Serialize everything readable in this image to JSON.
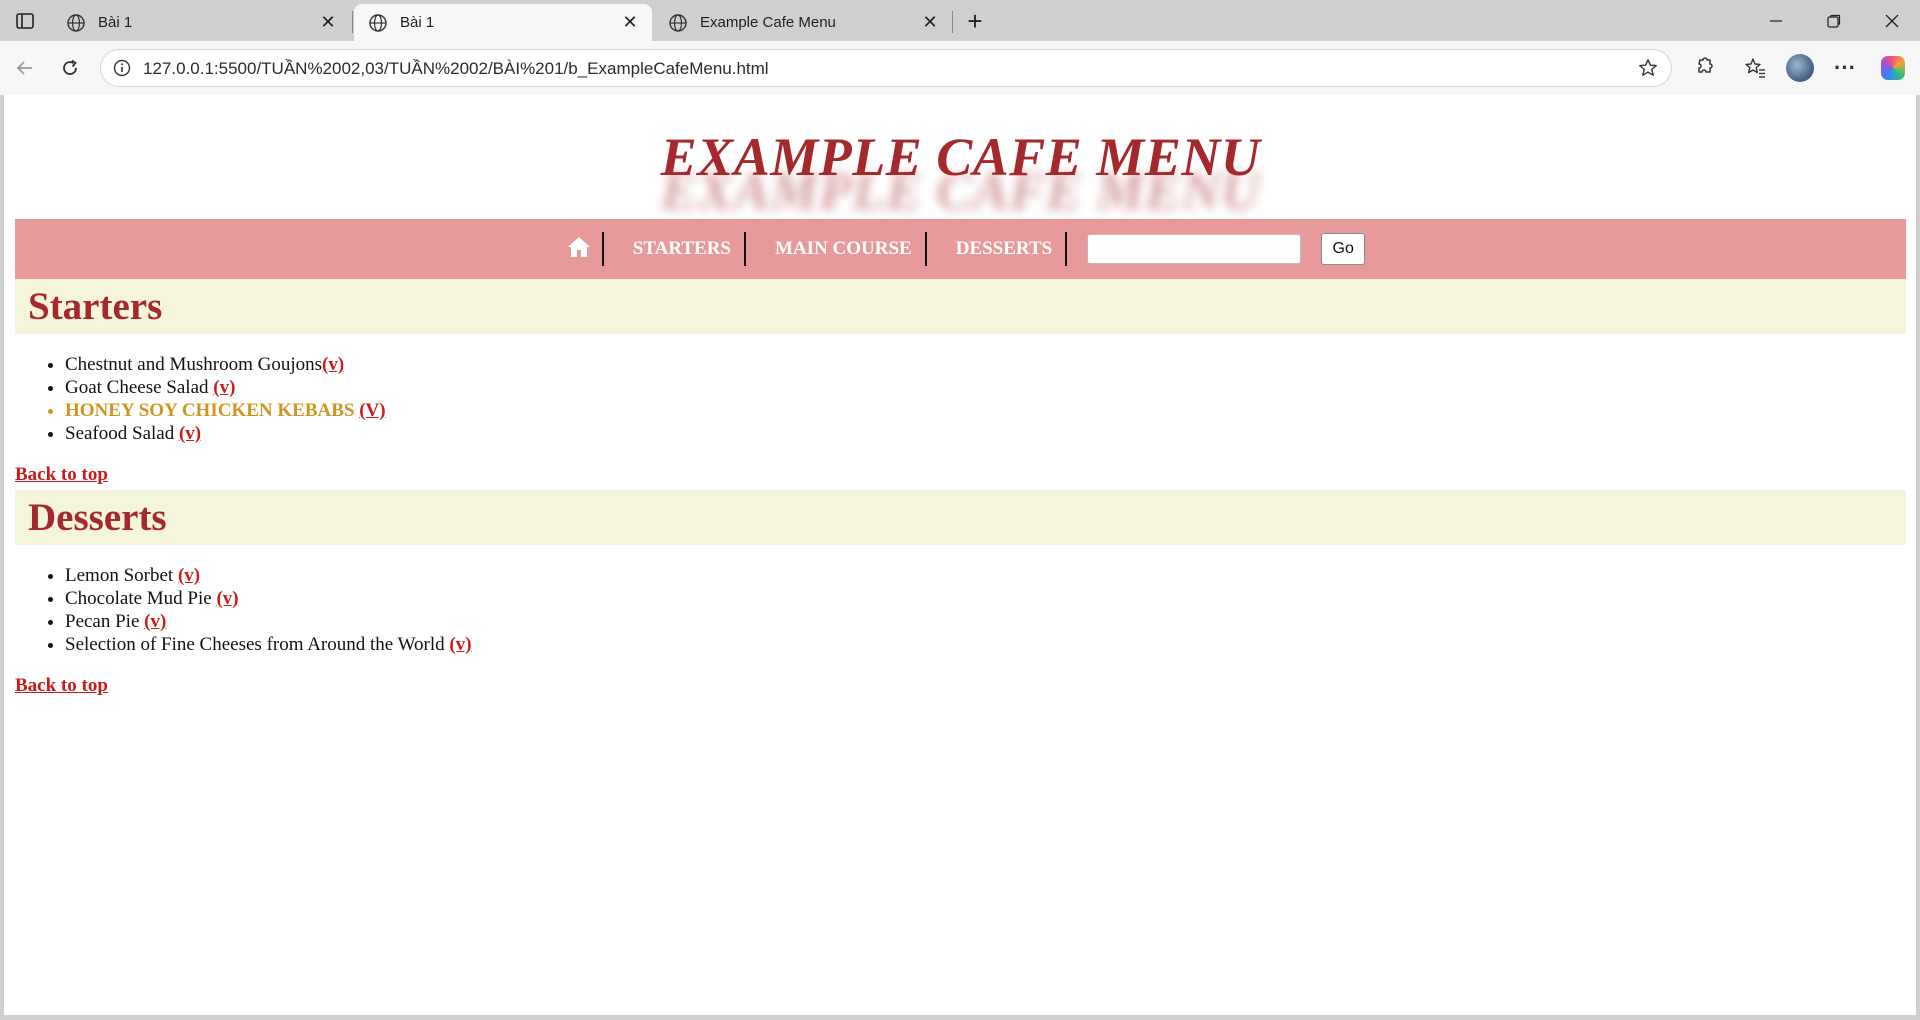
{
  "browser": {
    "tabs": [
      {
        "title": "Bài 1",
        "active": false
      },
      {
        "title": "Bài 1",
        "active": true
      },
      {
        "title": "Example Cafe Menu",
        "active": false
      }
    ],
    "address": "127.0.0.1:5500/TUẦN%2002,03/TUẦN%2002/BÀI%201/b_ExampleCafeMenu.html",
    "icons": [
      "tab-actions-icon",
      "globe-icon",
      "close-icon",
      "new-tab-icon",
      "minimize-icon",
      "restore-icon",
      "window-close-icon",
      "back-icon",
      "reload-icon",
      "site-info-icon",
      "favorite-star-icon",
      "extensions-icon",
      "favorites-icon",
      "profile-avatar",
      "more-icon",
      "copilot-icon"
    ]
  },
  "page": {
    "title": "EXAMPLE CAFE MENU",
    "nav": {
      "home_icon": "home-icon",
      "items": [
        "STARTERS",
        "MAIN COURSE",
        "DESSERTS"
      ],
      "search_value": "",
      "go_label": "Go"
    },
    "colors": {
      "title": "#a5282d",
      "navbar": "#e89a9a",
      "section_bg": "#f5f5dc",
      "link": "#cc1a1a",
      "featured": "#d0951e"
    },
    "sections": [
      {
        "heading": "Starters",
        "items": [
          {
            "name": "Chestnut and Mushroom Goujons",
            "tag": "(v)",
            "featured": false
          },
          {
            "name": "Goat Cheese Salad ",
            "tag": "(v)",
            "featured": false
          },
          {
            "name": "HONEY SOY CHICKEN KEBABS ",
            "tag": "(V)",
            "featured": true
          },
          {
            "name": "Seafood Salad ",
            "tag": "(v)",
            "featured": false
          }
        ],
        "back_to_top": "Back to top"
      },
      {
        "heading": "Desserts",
        "items": [
          {
            "name": "Lemon Sorbet ",
            "tag": "(v)",
            "featured": false
          },
          {
            "name": "Chocolate Mud Pie ",
            "tag": "(v)",
            "featured": false
          },
          {
            "name": "Pecan Pie ",
            "tag": "(v)",
            "featured": false
          },
          {
            "name": "Selection of Fine Cheeses from Around the World ",
            "tag": "(v)",
            "featured": false
          }
        ],
        "back_to_top": "Back to top"
      }
    ]
  }
}
